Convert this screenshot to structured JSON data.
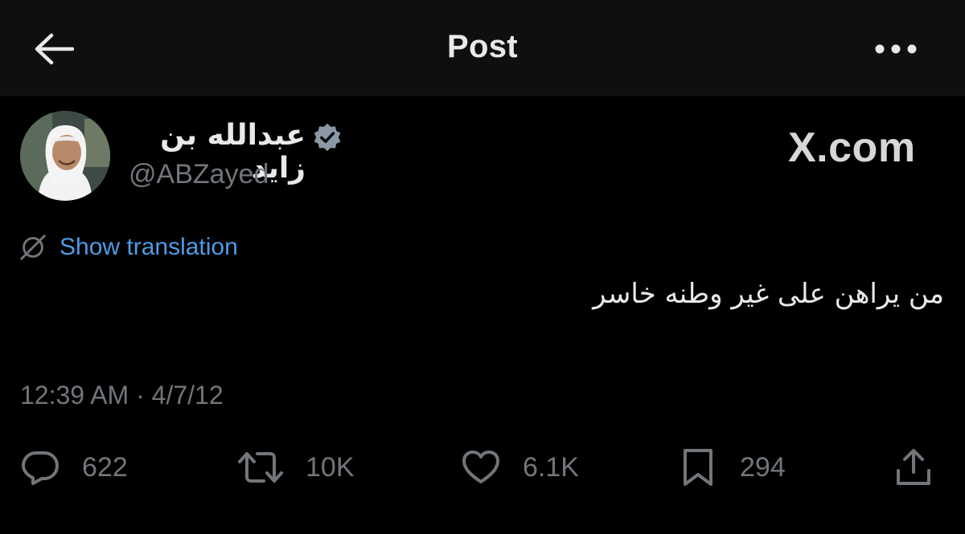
{
  "header": {
    "back_icon": "arrow-left-icon",
    "title": "Post",
    "more_icon": "more-horizontal-icon"
  },
  "author": {
    "name": "عبدالله بن زايد",
    "handle": "@ABZayed",
    "verified_icon": "verified-badge-icon",
    "verified_color": "#8b98a5"
  },
  "watermark": "X.com",
  "translation": {
    "icon": "globe-slash-icon",
    "label": "Show translation",
    "color": "#4c9be6"
  },
  "tweet": {
    "text": "من يراهن على غير وطنه خاسر"
  },
  "timestamp": "12:39 AM · 4/7/12",
  "actions": {
    "reply": {
      "icon": "reply-icon",
      "count": "622"
    },
    "repost": {
      "icon": "repost-icon",
      "count": "10K"
    },
    "like": {
      "icon": "heart-icon",
      "count": "6.1K"
    },
    "bookmark": {
      "icon": "bookmark-icon",
      "count": "294"
    },
    "share": {
      "icon": "share-icon"
    }
  },
  "colors": {
    "background": "#000000",
    "header_bg": "#0f0f0f",
    "primary_text": "#e7e9ea",
    "secondary_text": "#71767b"
  }
}
